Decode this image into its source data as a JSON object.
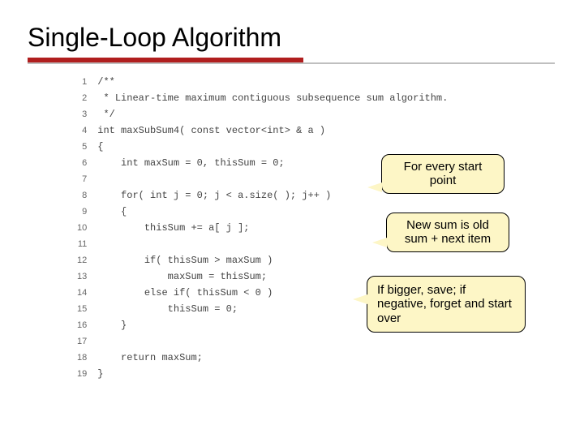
{
  "title": "Single-Loop Algorithm",
  "callouts": {
    "c1": "For every start point",
    "c2": "New sum is old sum + next item",
    "c3": "If bigger, save; if negative, forget and start over"
  },
  "code": {
    "lines": [
      {
        "n": "1",
        "t": "/**"
      },
      {
        "n": "2",
        "t": " * Linear-time maximum contiguous subsequence sum algorithm."
      },
      {
        "n": "3",
        "t": " */"
      },
      {
        "n": "4",
        "t": "int maxSubSum4( const vector<int> & a )"
      },
      {
        "n": "5",
        "t": "{"
      },
      {
        "n": "6",
        "t": "    int maxSum = 0, thisSum = 0;"
      },
      {
        "n": "7",
        "t": ""
      },
      {
        "n": "8",
        "t": "    for( int j = 0; j < a.size( ); j++ )"
      },
      {
        "n": "9",
        "t": "    {"
      },
      {
        "n": "10",
        "t": "        thisSum += a[ j ];"
      },
      {
        "n": "11",
        "t": ""
      },
      {
        "n": "12",
        "t": "        if( thisSum > maxSum )"
      },
      {
        "n": "13",
        "t": "            maxSum = thisSum;"
      },
      {
        "n": "14",
        "t": "        else if( thisSum < 0 )"
      },
      {
        "n": "15",
        "t": "            thisSum = 0;"
      },
      {
        "n": "16",
        "t": "    }"
      },
      {
        "n": "17",
        "t": ""
      },
      {
        "n": "18",
        "t": "    return maxSum;"
      },
      {
        "n": "19",
        "t": "}"
      }
    ]
  }
}
